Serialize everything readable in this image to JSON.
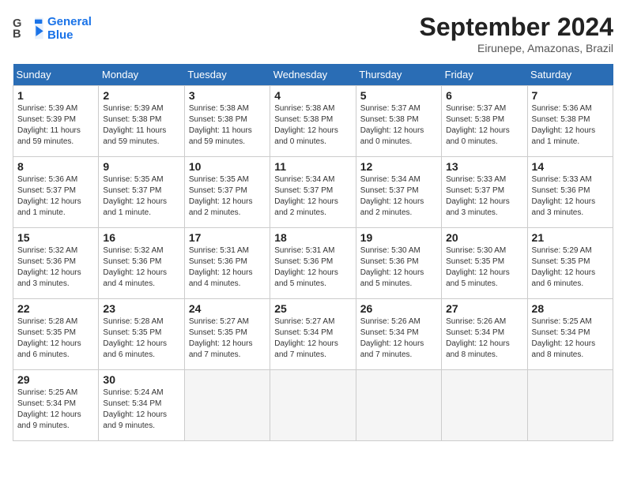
{
  "header": {
    "logo_line1": "General",
    "logo_line2": "Blue",
    "month": "September 2024",
    "location": "Eirunepe, Amazonas, Brazil"
  },
  "weekdays": [
    "Sunday",
    "Monday",
    "Tuesday",
    "Wednesday",
    "Thursday",
    "Friday",
    "Saturday"
  ],
  "weeks": [
    [
      {
        "day": "1",
        "rise": "5:39 AM",
        "set": "5:39 PM",
        "hours": "11 hours and 59 minutes"
      },
      {
        "day": "2",
        "rise": "5:39 AM",
        "set": "5:38 PM",
        "hours": "11 hours and 59 minutes"
      },
      {
        "day": "3",
        "rise": "5:38 AM",
        "set": "5:38 PM",
        "hours": "11 hours and 59 minutes"
      },
      {
        "day": "4",
        "rise": "5:38 AM",
        "set": "5:38 PM",
        "hours": "12 hours and 0 minutes"
      },
      {
        "day": "5",
        "rise": "5:37 AM",
        "set": "5:38 PM",
        "hours": "12 hours and 0 minutes"
      },
      {
        "day": "6",
        "rise": "5:37 AM",
        "set": "5:38 PM",
        "hours": "12 hours and 0 minutes"
      },
      {
        "day": "7",
        "rise": "5:36 AM",
        "set": "5:38 PM",
        "hours": "12 hours and 1 minute"
      }
    ],
    [
      {
        "day": "8",
        "rise": "5:36 AM",
        "set": "5:37 PM",
        "hours": "12 hours and 1 minute"
      },
      {
        "day": "9",
        "rise": "5:35 AM",
        "set": "5:37 PM",
        "hours": "12 hours and 1 minute"
      },
      {
        "day": "10",
        "rise": "5:35 AM",
        "set": "5:37 PM",
        "hours": "12 hours and 2 minutes"
      },
      {
        "day": "11",
        "rise": "5:34 AM",
        "set": "5:37 PM",
        "hours": "12 hours and 2 minutes"
      },
      {
        "day": "12",
        "rise": "5:34 AM",
        "set": "5:37 PM",
        "hours": "12 hours and 2 minutes"
      },
      {
        "day": "13",
        "rise": "5:33 AM",
        "set": "5:37 PM",
        "hours": "12 hours and 3 minutes"
      },
      {
        "day": "14",
        "rise": "5:33 AM",
        "set": "5:36 PM",
        "hours": "12 hours and 3 minutes"
      }
    ],
    [
      {
        "day": "15",
        "rise": "5:32 AM",
        "set": "5:36 PM",
        "hours": "12 hours and 3 minutes"
      },
      {
        "day": "16",
        "rise": "5:32 AM",
        "set": "5:36 PM",
        "hours": "12 hours and 4 minutes"
      },
      {
        "day": "17",
        "rise": "5:31 AM",
        "set": "5:36 PM",
        "hours": "12 hours and 4 minutes"
      },
      {
        "day": "18",
        "rise": "5:31 AM",
        "set": "5:36 PM",
        "hours": "12 hours and 5 minutes"
      },
      {
        "day": "19",
        "rise": "5:30 AM",
        "set": "5:36 PM",
        "hours": "12 hours and 5 minutes"
      },
      {
        "day": "20",
        "rise": "5:30 AM",
        "set": "5:35 PM",
        "hours": "12 hours and 5 minutes"
      },
      {
        "day": "21",
        "rise": "5:29 AM",
        "set": "5:35 PM",
        "hours": "12 hours and 6 minutes"
      }
    ],
    [
      {
        "day": "22",
        "rise": "5:28 AM",
        "set": "5:35 PM",
        "hours": "12 hours and 6 minutes"
      },
      {
        "day": "23",
        "rise": "5:28 AM",
        "set": "5:35 PM",
        "hours": "12 hours and 6 minutes"
      },
      {
        "day": "24",
        "rise": "5:27 AM",
        "set": "5:35 PM",
        "hours": "12 hours and 7 minutes"
      },
      {
        "day": "25",
        "rise": "5:27 AM",
        "set": "5:34 PM",
        "hours": "12 hours and 7 minutes"
      },
      {
        "day": "26",
        "rise": "5:26 AM",
        "set": "5:34 PM",
        "hours": "12 hours and 7 minutes"
      },
      {
        "day": "27",
        "rise": "5:26 AM",
        "set": "5:34 PM",
        "hours": "12 hours and 8 minutes"
      },
      {
        "day": "28",
        "rise": "5:25 AM",
        "set": "5:34 PM",
        "hours": "12 hours and 8 minutes"
      }
    ],
    [
      {
        "day": "29",
        "rise": "5:25 AM",
        "set": "5:34 PM",
        "hours": "12 hours and 9 minutes"
      },
      {
        "day": "30",
        "rise": "5:24 AM",
        "set": "5:34 PM",
        "hours": "12 hours and 9 minutes"
      },
      null,
      null,
      null,
      null,
      null
    ]
  ]
}
